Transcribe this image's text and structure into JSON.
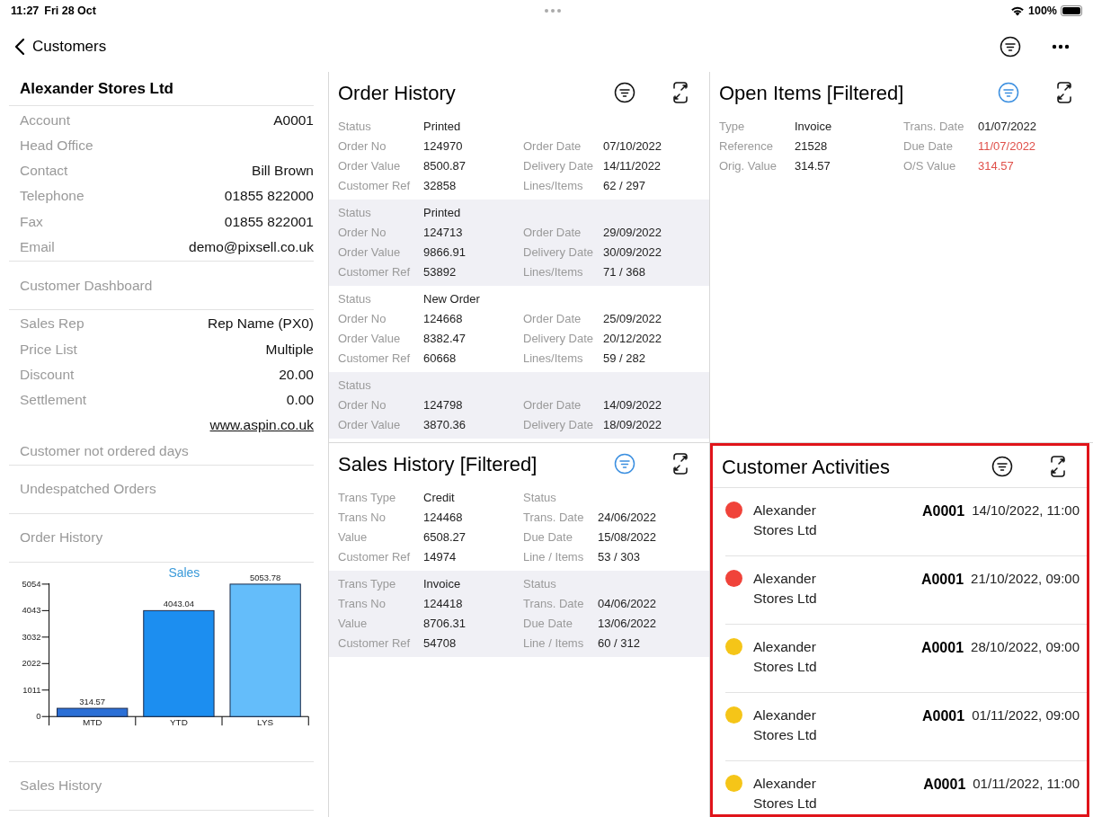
{
  "status_bar": {
    "time": "11:27",
    "date": "Fri 28 Oct",
    "battery": "100%"
  },
  "nav": {
    "back": "Customers"
  },
  "customer": {
    "items": [
      {
        "kind": "title",
        "text": "Alexander Stores Ltd"
      },
      {
        "kind": "fields",
        "rows": [
          {
            "label": "Account",
            "value": "A0001"
          },
          {
            "label": "Head Office"
          },
          {
            "label": "Contact",
            "value": "Bill Brown"
          },
          {
            "label": "Telephone",
            "value": "01855 822000"
          },
          {
            "label": "Fax",
            "value": "01855 822001"
          },
          {
            "label": "Email",
            "value": "demo@pixsell.co.uk"
          }
        ]
      },
      {
        "kind": "heading",
        "text": "Customer Dashboard"
      },
      {
        "kind": "fields",
        "rows": [
          {
            "label": "Sales Rep",
            "value": "Rep Name (PX0)"
          },
          {
            "label": "Price List",
            "value": "Multiple"
          },
          {
            "label": "Discount",
            "value": "20.00"
          },
          {
            "label": "Settlement",
            "value": "0.00"
          },
          {
            "link": "www.aspin.co.uk"
          },
          {
            "label": "Customer not ordered days"
          }
        ]
      },
      {
        "kind": "heading",
        "text": "Undespatched Orders"
      },
      {
        "kind": "heading",
        "text": "Order History"
      },
      {
        "kind": "chart",
        "chart_data": {
          "type": "bar",
          "title": "Sales",
          "categories": [
            "MTD",
            "YTD",
            "LYS"
          ],
          "series": [
            {
              "values": [
                314.57,
                4043.04,
                5053.78
              ]
            }
          ],
          "ylim": [
            0,
            5054
          ],
          "yticks": [
            0,
            1011,
            2022,
            3032,
            4043,
            5054
          ],
          "data_labels": true
        }
      },
      {
        "kind": "heading",
        "text": "Sales History"
      }
    ]
  },
  "order_history": {
    "title": "Order History",
    "filter_active": false,
    "records": [
      {
        "left": [
          {
            "label": "Status",
            "value": "Printed"
          },
          {
            "label": "Order No",
            "value": "124970"
          },
          {
            "label": "Order Value",
            "value": "8500.87"
          },
          {
            "label": "Customer Ref",
            "value": "32858"
          }
        ],
        "right": [
          {
            "label": "Order Date",
            "value": "07/10/2022"
          },
          {
            "label": "Delivery Date",
            "value": "14/11/2022"
          },
          {
            "label": "Lines/Items",
            "value": "62 / 297"
          }
        ]
      },
      {
        "left": [
          {
            "label": "Status",
            "value": "Printed"
          },
          {
            "label": "Order No",
            "value": "124713"
          },
          {
            "label": "Order Value",
            "value": "9866.91"
          },
          {
            "label": "Customer Ref",
            "value": "53892"
          }
        ],
        "right": [
          {
            "label": "Order Date",
            "value": "29/09/2022"
          },
          {
            "label": "Delivery Date",
            "value": "30/09/2022"
          },
          {
            "label": "Lines/Items",
            "value": "71 / 368"
          }
        ]
      },
      {
        "left": [
          {
            "label": "Status",
            "value": "New Order"
          },
          {
            "label": "Order No",
            "value": "124668"
          },
          {
            "label": "Order Value",
            "value": "8382.47"
          },
          {
            "label": "Customer Ref",
            "value": "60668"
          }
        ],
        "right": [
          {
            "label": "Order Date",
            "value": "25/09/2022"
          },
          {
            "label": "Delivery Date",
            "value": "20/12/2022"
          },
          {
            "label": "Lines/Items",
            "value": "59 / 282"
          }
        ]
      },
      {
        "left": [
          {
            "label": "Status"
          },
          {
            "label": "Order No",
            "value": "124798"
          },
          {
            "label": "Order Value",
            "value": "3870.36"
          }
        ],
        "right": [
          {
            "label": "Order Date",
            "value": "14/09/2022"
          },
          {
            "label": "Delivery Date",
            "value": "18/09/2022"
          }
        ]
      }
    ]
  },
  "open_items": {
    "title": "Open Items [Filtered]",
    "filter_active": true,
    "records": [
      {
        "left": [
          {
            "label": "Type",
            "value": "Invoice"
          },
          {
            "label": "Reference",
            "value": "21528"
          },
          {
            "label": "Orig. Value",
            "value": "314.57"
          }
        ],
        "right": [
          {
            "label": "Trans. Date",
            "value": "01/07/2022",
            "overdue": false
          },
          {
            "label": "Due Date",
            "value": "11/07/2022",
            "overdue": true
          },
          {
            "label": "O/S Value",
            "value": "314.57",
            "overdue": true
          }
        ]
      }
    ]
  },
  "sales_history": {
    "title": "Sales History [Filtered]",
    "filter_active": true,
    "records": [
      {
        "left": [
          {
            "label": "Trans Type",
            "value": "Credit"
          },
          {
            "label": "Trans No",
            "value": "124468"
          },
          {
            "label": "Value",
            "value": "6508.27"
          },
          {
            "label": "Customer Ref",
            "value": "14974"
          }
        ],
        "right": [
          {
            "label": "Status"
          },
          {
            "label": "Trans. Date",
            "value": "24/06/2022"
          },
          {
            "label": "Due Date",
            "value": "15/08/2022"
          },
          {
            "label": "Line / Items",
            "value": "53 / 303"
          }
        ]
      },
      {
        "left": [
          {
            "label": "Trans Type",
            "value": "Invoice"
          },
          {
            "label": "Trans No",
            "value": "124418"
          },
          {
            "label": "Value",
            "value": "8706.31"
          },
          {
            "label": "Customer Ref",
            "value": "54708"
          }
        ],
        "right": [
          {
            "label": "Status"
          },
          {
            "label": "Trans. Date",
            "value": "04/06/2022"
          },
          {
            "label": "Due Date",
            "value": "13/06/2022"
          },
          {
            "label": "Line / Items",
            "value": "60 / 312"
          }
        ]
      }
    ]
  },
  "customer_activities": {
    "title": "Customer Activities",
    "filter_active": false,
    "highlighted": true,
    "items": [
      {
        "color": "#f0433a",
        "name": "Alexander Stores Ltd",
        "account": "A0001",
        "datetime": "14/10/2022, 11:00"
      },
      {
        "color": "#f0433a",
        "name": "Alexander Stores Ltd",
        "account": "A0001",
        "datetime": "21/10/2022, 09:00"
      },
      {
        "color": "#f5c518",
        "name": "Alexander Stores Ltd",
        "account": "A0001",
        "datetime": "28/10/2022, 09:00"
      },
      {
        "color": "#f5c518",
        "name": "Alexander Stores Ltd",
        "account": "A0001",
        "datetime": "01/11/2022, 09:00"
      },
      {
        "color": "#f5c518",
        "name": "Alexander Stores Ltd",
        "account": "A0001",
        "datetime": "01/11/2022, 11:00"
      }
    ]
  }
}
